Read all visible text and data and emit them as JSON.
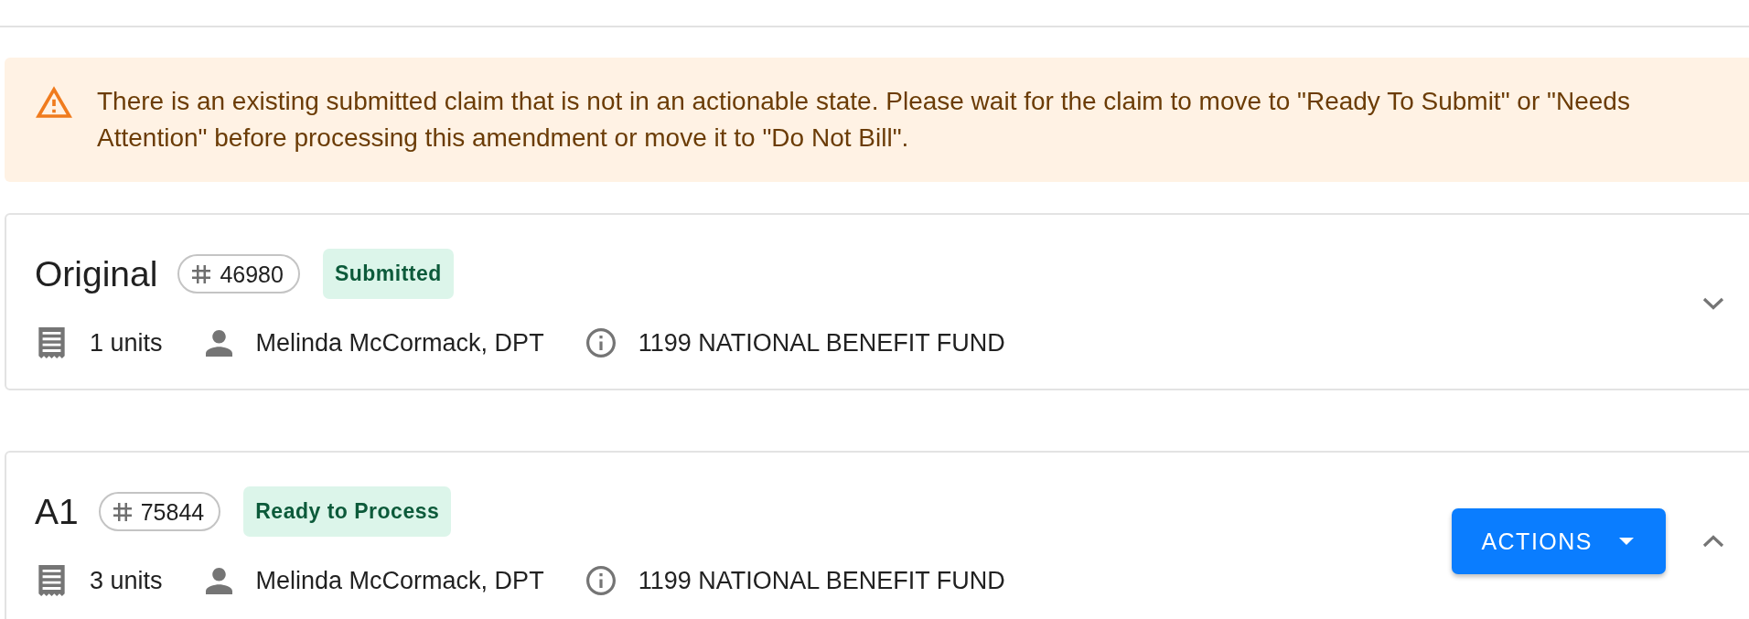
{
  "alert": {
    "kind": "warning",
    "message": "There is an existing submitted claim that is not in an actionable state. Please wait for the claim to move to \"Ready To Submit\" or \"Needs Attention\" before processing this amendment or move it to \"Do Not Bill\"."
  },
  "claims": [
    {
      "title": "Original",
      "number": "46980",
      "status": "Submitted",
      "units": "1 units",
      "provider": "Melinda McCormack, DPT",
      "payer": "1199 NATIONAL BENEFIT FUND",
      "expanded": false
    },
    {
      "title": "A1",
      "number": "75844",
      "status": "Ready to Process",
      "units": "3 units",
      "provider": "Melinda McCormack, DPT",
      "payer": "1199 NATIONAL BENEFIT FUND",
      "expanded": true,
      "actions_button": "ACTIONS"
    }
  ]
}
